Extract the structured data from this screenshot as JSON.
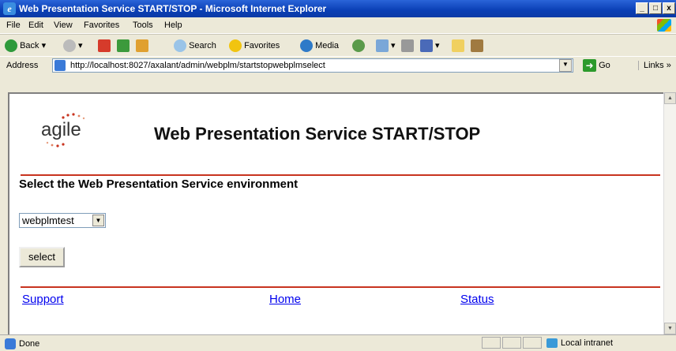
{
  "window": {
    "title": "Web Presentation Service START/STOP - Microsoft Internet Explorer",
    "controls": [
      "_",
      "□",
      "x"
    ]
  },
  "menu": [
    "File",
    "Edit",
    "View",
    "Favorites",
    "Tools",
    "Help"
  ],
  "toolbar": {
    "back": "Back",
    "search": "Search",
    "favorites": "Favorites",
    "media": "Media"
  },
  "address": {
    "label": "Address",
    "url": "http://localhost:8027/axalant/admin/webplm/startstopwebplmselect",
    "go": "Go",
    "links": "Links"
  },
  "page": {
    "logo_text": "agile",
    "title": "Web Presentation Service START/STOP",
    "section_title": "Select the Web Presentation Service environment",
    "environment_value": "webplmtest",
    "select_button": "select",
    "footer_links": [
      "Support",
      "Home",
      "Status"
    ]
  },
  "status": {
    "text": "Done",
    "zone": "Local intranet"
  },
  "colors": {
    "rule": "#c8331f",
    "link": "#0000ee",
    "titlebar": "#0a3fb5"
  }
}
